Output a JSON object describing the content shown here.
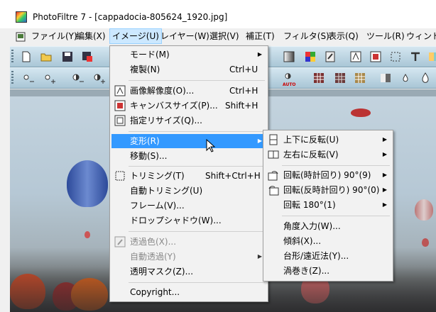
{
  "window": {
    "title": "PhotoFiltre 7 - [cappadocia-805624_1920.jpg]"
  },
  "menubar": {
    "items": [
      {
        "label": "ファイル(Y)"
      },
      {
        "label": "編集(X)"
      },
      {
        "label": "イメージ(U)"
      },
      {
        "label": "レイヤー(W)"
      },
      {
        "label": "選択(V)"
      },
      {
        "label": "補正(T)"
      },
      {
        "label": "フィルタ(S)"
      },
      {
        "label": "表示(Q)"
      },
      {
        "label": "ツール(R)"
      },
      {
        "label": "ウィンドウ"
      }
    ],
    "active_index": 2
  },
  "image_menu": {
    "items": [
      {
        "label": "モード(M)",
        "shortcut": "",
        "submenu": true
      },
      {
        "label": "複製(N)",
        "shortcut": "Ctrl+U"
      },
      {
        "label": "画像解像度(O)...",
        "shortcut": "Ctrl+H",
        "icon": "image-resolution-icon"
      },
      {
        "label": "キャンバスサイズ(P)...",
        "shortcut": "Shift+H",
        "icon": "canvas-size-icon"
      },
      {
        "label": "指定リサイズ(Q)...",
        "shortcut": "",
        "icon": "fit-size-icon"
      },
      {
        "label": "変形(R)",
        "shortcut": "",
        "submenu": true,
        "highlighted": true
      },
      {
        "label": "移動(S)...",
        "shortcut": ""
      },
      {
        "label": "トリミング(T)",
        "shortcut": "Shift+Ctrl+H",
        "icon": "crop-icon"
      },
      {
        "label": "自動トリミング(U)",
        "shortcut": ""
      },
      {
        "label": "フレーム(V)...",
        "shortcut": ""
      },
      {
        "label": "ドロップシャドウ(W)...",
        "shortcut": ""
      },
      {
        "label": "透過色(X)...",
        "shortcut": "",
        "disabled": true,
        "icon": "transparent-color-icon"
      },
      {
        "label": "自動透過(Y)",
        "shortcut": "",
        "disabled": true,
        "submenu": true
      },
      {
        "label": "透明マスク(Z)...",
        "shortcut": ""
      },
      {
        "label": "Copyright...",
        "shortcut": ""
      }
    ]
  },
  "transform_submenu": {
    "items": [
      {
        "label": "上下に反転(U)",
        "submenu": true,
        "icon": "flip-vertical-icon"
      },
      {
        "label": "左右に反転(V)",
        "submenu": true,
        "icon": "flip-horizontal-icon"
      },
      {
        "label": "回転(時計回り) 90°(9)",
        "submenu": true,
        "icon": "rotate-clockwise-icon"
      },
      {
        "label": "回転(反時計回り) 90°(0)",
        "submenu": true,
        "icon": "rotate-counterclockwise-icon"
      },
      {
        "label": "回転 180°(1)",
        "submenu": true
      },
      {
        "label": "角度入力(W)..."
      },
      {
        "label": "傾斜(X)..."
      },
      {
        "label": "台形/遠近法(Y)..."
      },
      {
        "label": "渦巻き(Z)..."
      }
    ]
  },
  "toolbar": {
    "auto_label": "AUTO"
  },
  "colors": {
    "highlight": "#3399ff",
    "menubar_active": "#cce8ff",
    "toolbar_top": "#d4e6f0",
    "toolbar_bottom": "#a9c6d6"
  }
}
